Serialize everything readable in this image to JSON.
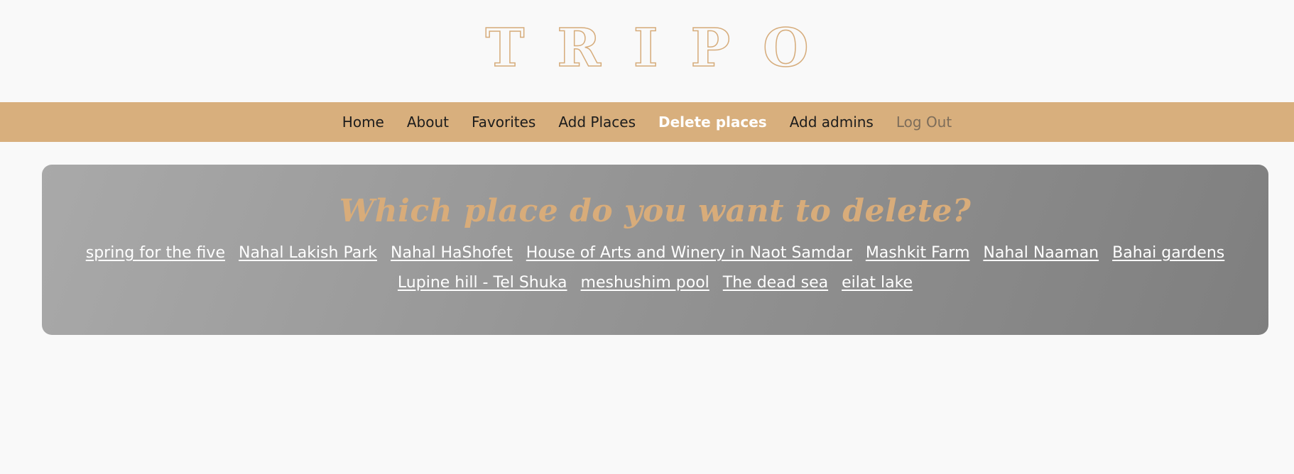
{
  "logo": {
    "text": "TRIPO"
  },
  "nav": {
    "items": [
      {
        "label": "Home",
        "state": "normal"
      },
      {
        "label": "About",
        "state": "normal"
      },
      {
        "label": "Favorites",
        "state": "normal"
      },
      {
        "label": "Add Places",
        "state": "normal"
      },
      {
        "label": "Delete places",
        "state": "active"
      },
      {
        "label": "Add admins",
        "state": "normal"
      },
      {
        "label": "Log Out",
        "state": "muted"
      }
    ]
  },
  "main": {
    "title": "Which place do you want to delete?",
    "places": [
      "spring for the five",
      "Nahal Lakish Park",
      "Nahal HaShofet",
      "House of Arts and Winery in Naot Samdar",
      "Mashkit Farm",
      "Nahal Naaman",
      "Bahai gardens",
      "Lupine hill - Tel Shuka",
      "meshushim pool",
      "The dead sea",
      "eilat lake"
    ]
  },
  "colors": {
    "accent": "#d8af7d",
    "background": "#f9f9f9",
    "panel_light": "#a9a9a9",
    "panel_dark": "#7f7f7f"
  }
}
